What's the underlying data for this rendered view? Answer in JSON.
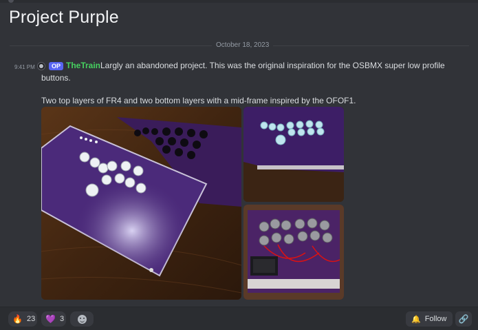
{
  "thread": {
    "title": "Project Purple"
  },
  "date_divider": "October 18, 2023",
  "message": {
    "timestamp": "9:41 PM",
    "badge": "OP",
    "author": "TheTrain",
    "text_line1": "Largly an abandoned project.  This was the original inspiration for the OSBMX super low profile",
    "text_line2": "buttons.",
    "text_line3": "Two top layers of FR4 and two bottom layers with a mid-frame inspired by the OFOF1.",
    "author_color": "#46d160"
  },
  "attachments": [
    "photo-main",
    "photo-top-right",
    "photo-bottom-right"
  ],
  "footer": {
    "reactions": [
      {
        "emoji": "🔥",
        "count": "23"
      },
      {
        "emoji": "💜",
        "count": "3"
      }
    ],
    "add_reaction_icon": "smiley-icon",
    "follow_label": "Follow",
    "link_icon": "link-icon"
  },
  "colors": {
    "background": "#313338",
    "footer": "#2b2d31",
    "badge": "#5865f2"
  }
}
